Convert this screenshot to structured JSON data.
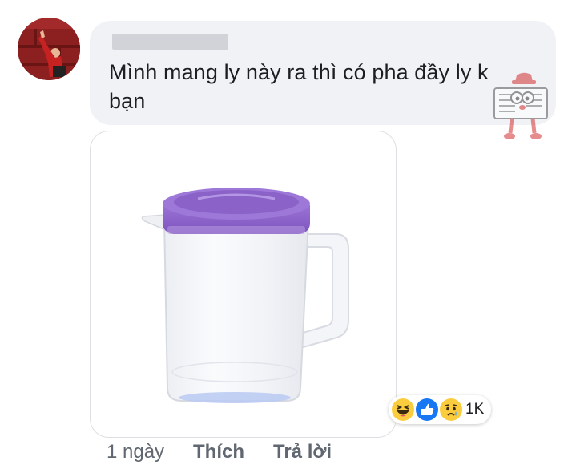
{
  "comment": {
    "author": "",
    "text": "Mình mang ly này ra thì có pha đầy ly k bạn",
    "attachment": "purple-lid-pitcher-image"
  },
  "reactions": {
    "icons": [
      "haha-icon",
      "like-icon",
      "sad-icon"
    ],
    "count": "1K"
  },
  "actions": {
    "time": "1 ngày",
    "like_label": "Thích",
    "reply_label": "Trả lời"
  },
  "colors": {
    "bubble": "#f1f2f6",
    "lid": "#8e63c9",
    "like_blue": "#1877f2",
    "reaction_yellow": "#fbcd3e"
  }
}
